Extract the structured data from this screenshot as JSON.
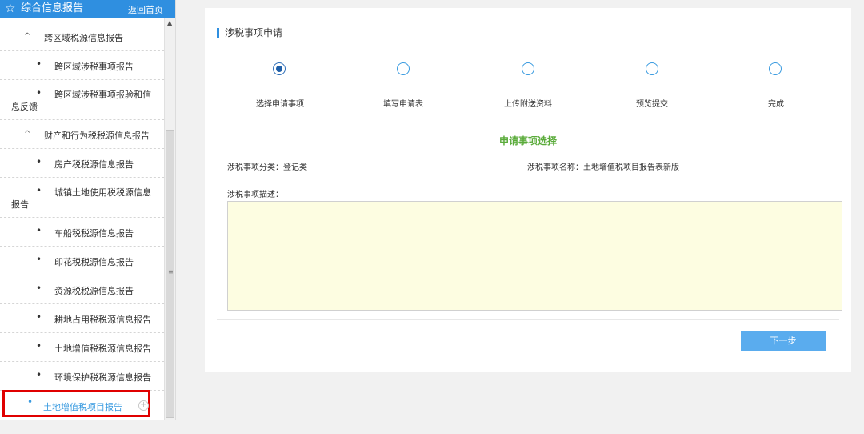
{
  "sidebar": {
    "header_title": "综合信息报告",
    "back_link": "返回首页",
    "items": [
      {
        "type": "group",
        "label": "跨区域税源信息报告"
      },
      {
        "type": "leaf",
        "label": "跨区域涉税事项报告"
      },
      {
        "type": "leaf-wrap",
        "label": "跨区域涉税事项报验和信息反馈"
      },
      {
        "type": "group",
        "label": "财产和行为税税源信息报告"
      },
      {
        "type": "leaf",
        "label": "房产税税源信息报告"
      },
      {
        "type": "leaf-wrap",
        "label": "城镇土地使用税税源信息报告"
      },
      {
        "type": "leaf",
        "label": "车船税税源信息报告"
      },
      {
        "type": "leaf",
        "label": "印花税税源信息报告"
      },
      {
        "type": "leaf",
        "label": "资源税税源信息报告"
      },
      {
        "type": "leaf",
        "label": "耕地占用税税源信息报告"
      },
      {
        "type": "leaf",
        "label": "土地增值税税源信息报告"
      },
      {
        "type": "leaf",
        "label": "环境保护税税源信息报告"
      }
    ],
    "active_item": "土地增值税项目报告"
  },
  "main": {
    "panel_title": "涉税事项申请",
    "steps": [
      "选择申请事项",
      "填写申请表",
      "上传附送资料",
      "预览提交",
      "完成"
    ],
    "current_step": 0,
    "section_title": "申请事项选择",
    "category_label": "涉税事项分类：登记类",
    "name_label": "涉税事项名称：土地增值税项目报告表新版",
    "description_label": "涉税事项描述：",
    "description_value": "",
    "next_button": "下一步"
  },
  "colors": {
    "header_blue": "#2f8fe0",
    "accent_blue": "#3a9be0",
    "section_green": "#5aab3a",
    "highlight_red": "#e00000",
    "textarea_bg": "#fdfde1",
    "button_blue": "#5aacee"
  }
}
